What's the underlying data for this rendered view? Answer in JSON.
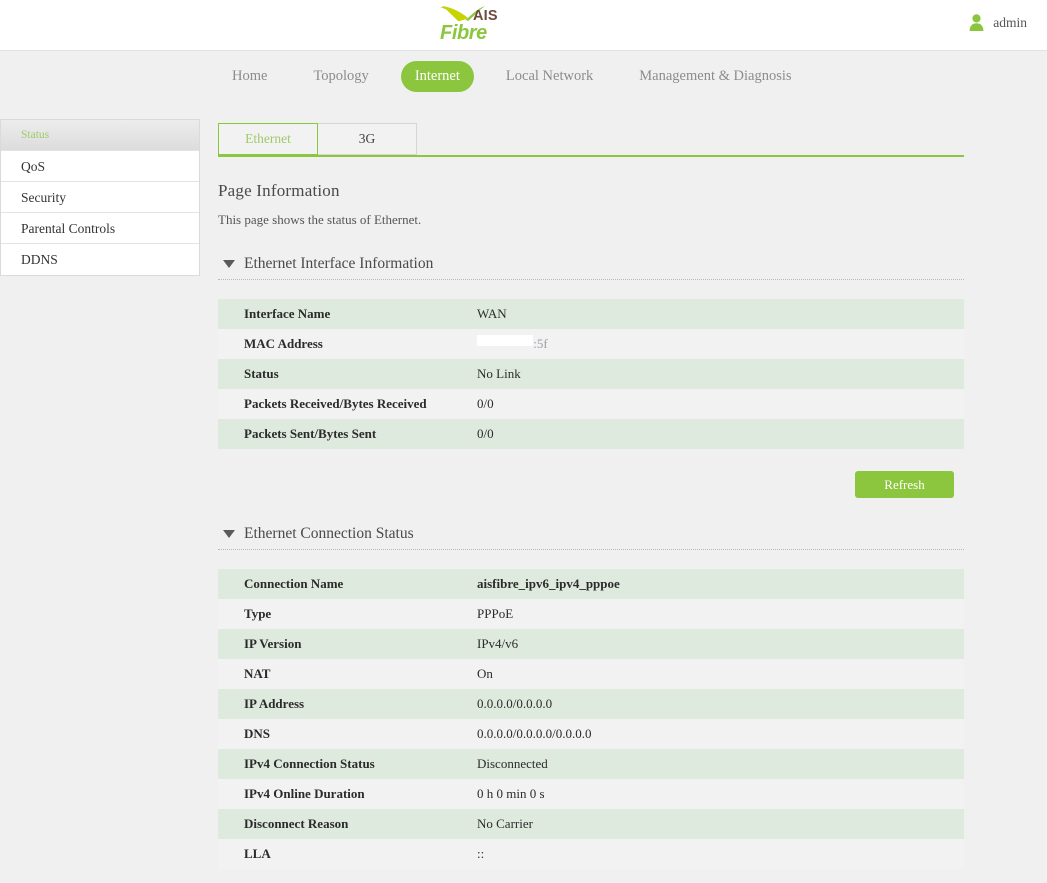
{
  "header": {
    "logo_primary": "AIS",
    "logo_secondary": "Fibre",
    "user_icon": "user-icon",
    "user_name": "admin"
  },
  "nav": {
    "items": [
      {
        "label": "Home",
        "active": false
      },
      {
        "label": "Topology",
        "active": false
      },
      {
        "label": "Internet",
        "active": true
      },
      {
        "label": "Local Network",
        "active": false
      },
      {
        "label": "Management & Diagnosis",
        "active": false
      }
    ]
  },
  "sidebar": {
    "items": [
      {
        "label": "Status",
        "active": true
      },
      {
        "label": "QoS",
        "active": false
      },
      {
        "label": "Security",
        "active": false
      },
      {
        "label": "Parental Controls",
        "active": false
      },
      {
        "label": "DDNS",
        "active": false
      }
    ]
  },
  "tabs": [
    {
      "label": "Ethernet",
      "active": true
    },
    {
      "label": "3G",
      "active": false
    }
  ],
  "page": {
    "title": "Page Information",
    "subtitle": "This page shows the status of Ethernet."
  },
  "sections": [
    {
      "title": "Ethernet Interface Information",
      "caret": "caret-down-icon",
      "rows": [
        {
          "key": "Interface Name",
          "value": "WAN"
        },
        {
          "key": "MAC Address",
          "value": "·············:5f",
          "redacted": true
        },
        {
          "key": "Status",
          "value": "No Link"
        },
        {
          "key": "Packets Received/Bytes Received",
          "value": "0/0"
        },
        {
          "key": "Packets Sent/Bytes Sent",
          "value": "0/0"
        }
      ]
    },
    {
      "title": "Ethernet Connection Status",
      "caret": "caret-down-icon",
      "rows": [
        {
          "key": "Connection Name",
          "value": "aisfibre_ipv6_ipv4_pppoe",
          "bold": true
        },
        {
          "key": "Type",
          "value": "PPPoE"
        },
        {
          "key": "IP Version",
          "value": "IPv4/v6"
        },
        {
          "key": "NAT",
          "value": "On"
        },
        {
          "key": "IP Address",
          "value": "0.0.0.0/0.0.0.0"
        },
        {
          "key": "DNS",
          "value": "0.0.0.0/0.0.0.0/0.0.0.0"
        },
        {
          "key": "IPv4 Connection Status",
          "value": "Disconnected"
        },
        {
          "key": "IPv4 Online Duration",
          "value": "0 h 0 min 0 s"
        },
        {
          "key": "Disconnect Reason",
          "value": "No Carrier"
        },
        {
          "key": "LLA",
          "value": "::"
        }
      ]
    }
  ],
  "buttons": {
    "refresh": "Refresh"
  },
  "colors": {
    "accent_green": "#8cc63f",
    "row_green": "#dfeade",
    "row_gray": "#f2f2f2",
    "page_bg": "#f0f0f0",
    "logo_brown": "#6d4b3a"
  }
}
